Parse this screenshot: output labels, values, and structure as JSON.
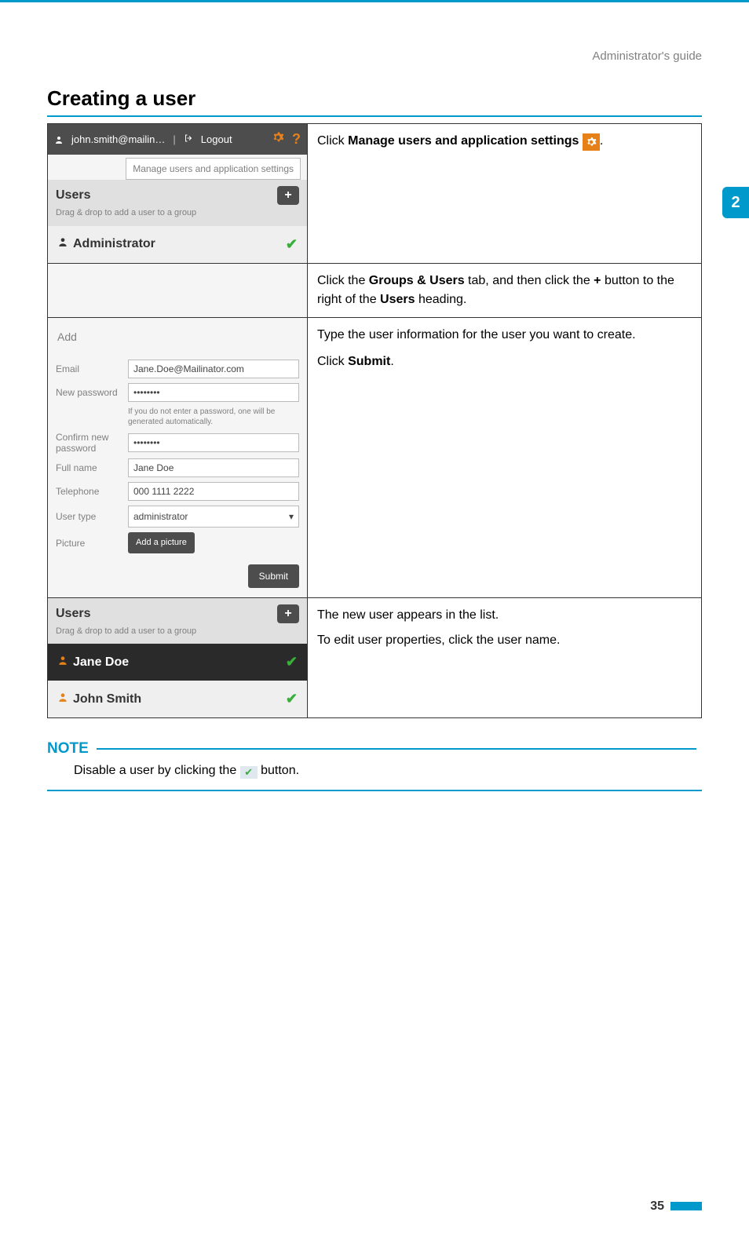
{
  "header": {
    "guide_label": "Administrator's guide"
  },
  "title": "Creating a user",
  "section_no": "2",
  "page_number": "35",
  "topbar": {
    "user": "john.smith@mailin…",
    "logout": "Logout",
    "tooltip": "Manage users and application settings"
  },
  "users_panel": {
    "title": "Users",
    "hint": "Drag & drop to add a user to a group",
    "admin_row": "Administrator",
    "jane": "Jane Doe",
    "john": "John Smith"
  },
  "form": {
    "add_title": "Add",
    "labels": {
      "email": "Email",
      "newpw": "New password",
      "confirm": "Confirm new password",
      "fullname": "Full name",
      "telephone": "Telephone",
      "usertype": "User type",
      "picture": "Picture"
    },
    "values": {
      "email": "Jane.Doe@Mailinator.com",
      "newpw": "••••••••",
      "confirm": "••••••••",
      "fullname": "Jane Doe",
      "telephone": "000 1111 2222",
      "usertype": "administrator"
    },
    "pw_hint": "If you do not enter a password, one will be generated automatically.",
    "add_picture": "Add a picture",
    "submit": "Submit"
  },
  "instructions": {
    "r1_a": "Click ",
    "r1_b": "Manage users and application settings",
    "r1_c": " ",
    "r1_d": ".",
    "r2_a": "Click the ",
    "r2_b": "Groups & Users",
    "r2_c": " tab, and then click the ",
    "r2_d": "+",
    "r2_e": " button to the right of the ",
    "r2_f": "Users",
    "r2_g": " heading.",
    "r3_a": "Type the user information for the user you want to create.",
    "r3_b": "Click ",
    "r3_c": "Submit",
    "r3_d": ".",
    "r4_a": "The new user appears in the list.",
    "r4_b": "To edit user properties, click the user name."
  },
  "note": {
    "title": "NOTE",
    "text_a": "Disable a user by clicking the ",
    "text_b": " button."
  }
}
